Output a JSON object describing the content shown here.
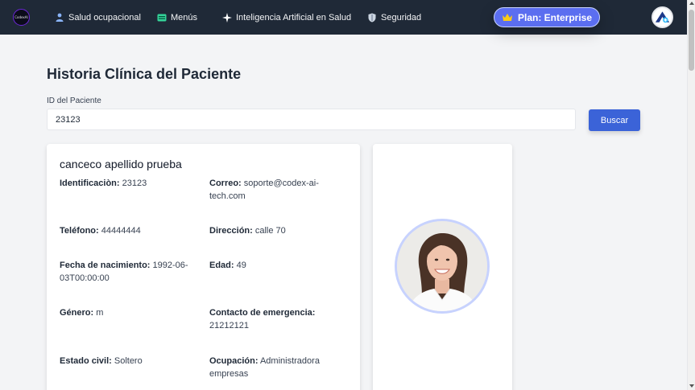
{
  "nav": {
    "logo_text": "CodexAI",
    "items": [
      {
        "label": "Salud ocupacional",
        "icon": "person-icon"
      },
      {
        "label": "Menús",
        "icon": "menu-card-icon"
      },
      {
        "label": "Inteligencia Artificial en Salud",
        "icon": "sparkle-icon"
      },
      {
        "label": "Seguridad",
        "icon": "shield-icon"
      }
    ],
    "plan_label": "Plan: Enterprise",
    "accent_color": "#5b6ef0"
  },
  "page": {
    "title": "Historia Clínica del Paciente",
    "id_label": "ID del Paciente",
    "id_value": "23123",
    "search_label": "Buscar"
  },
  "patient": {
    "name": "canceco apellido prueba",
    "fields": {
      "identificacion": {
        "label": "Identificaciòn:",
        "value": "23123"
      },
      "correo": {
        "label": "Correo:",
        "value": "soporte@codex-ai-tech.com"
      },
      "telefono": {
        "label": "Teléfono:",
        "value": "44444444"
      },
      "direccion": {
        "label": "Dirección:",
        "value": "calle 70"
      },
      "fecha": {
        "label": "Fecha de nacimiento:",
        "value": "1992-06-03T00:00:00"
      },
      "edad": {
        "label": "Edad:",
        "value": "49"
      },
      "genero": {
        "label": "Género:",
        "value": "m"
      },
      "contacto": {
        "label": "Contacto de emergencia:",
        "value": "21212121"
      },
      "estado": {
        "label": "Estado civil:",
        "value": "Soltero"
      },
      "ocupacion": {
        "label": "Ocupación:",
        "value": "Administradora empresas"
      }
    }
  }
}
